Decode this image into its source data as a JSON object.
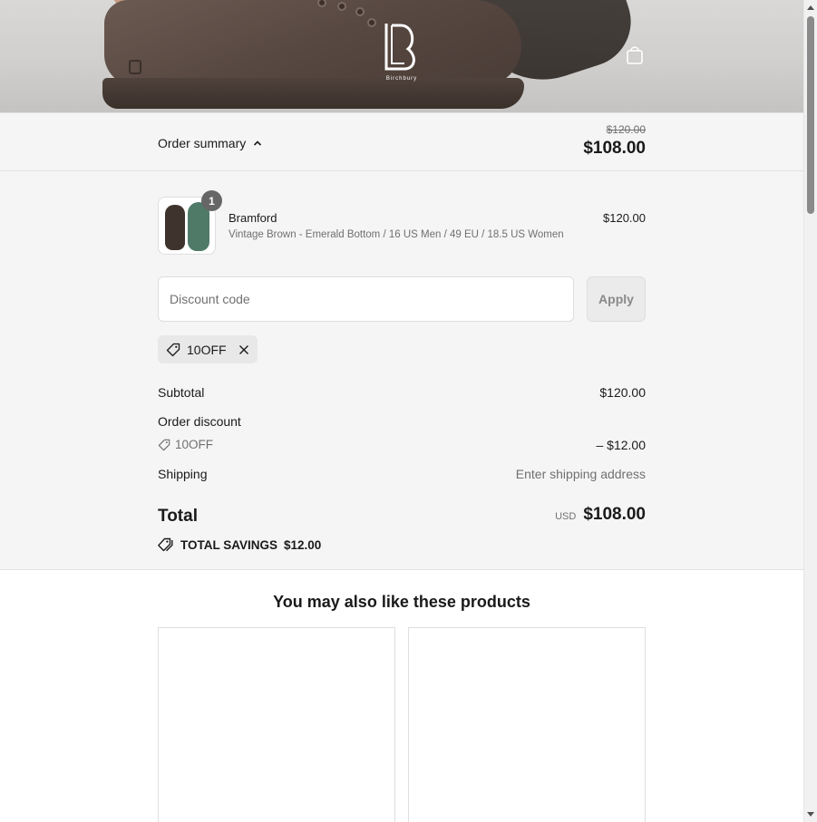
{
  "brand": {
    "logo_text": "Birchbury"
  },
  "summary_bar": {
    "toggle_label": "Order summary",
    "original_price": "$120.00",
    "price": "$108.00"
  },
  "product": {
    "quantity": "1",
    "name": "Bramford",
    "variant": "Vintage Brown - Emerald Bottom / 16 US Men / 49 EU / 18.5 US Women",
    "price": "$120.00"
  },
  "discount": {
    "placeholder": "Discount code",
    "value": "",
    "apply_label": "Apply",
    "applied_code": "10OFF"
  },
  "costs": {
    "subtotal_label": "Subtotal",
    "subtotal_value": "$120.00",
    "order_discount_label": "Order discount",
    "order_discount_code": "10OFF",
    "order_discount_value": "– $12.00",
    "shipping_label": "Shipping",
    "shipping_value": "Enter shipping address",
    "total_label": "Total",
    "currency": "USD",
    "total_value": "$108.00",
    "savings_label": "TOTAL SAVINGS",
    "savings_value": "$12.00"
  },
  "recommendations": {
    "title": "You may also like these products"
  },
  "colors": {
    "panel_background": "#f5f5f5",
    "text_primary": "#1a1a1a",
    "text_secondary": "#707070"
  },
  "icons": [
    "cart-icon",
    "chevron-up-icon",
    "tag-icon",
    "close-icon",
    "tag-icon",
    "double-tag-icon"
  ]
}
